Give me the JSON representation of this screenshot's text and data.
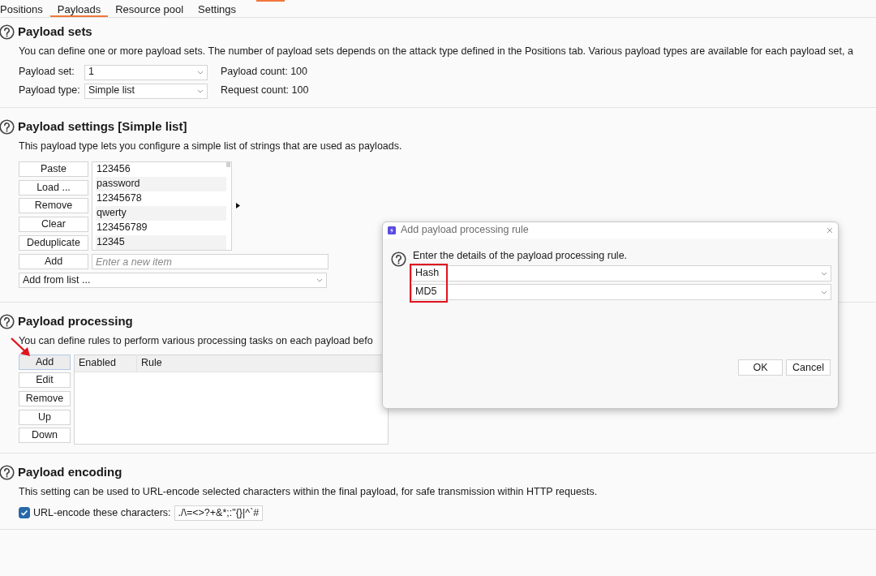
{
  "tabs": [
    {
      "label": "Positions",
      "selected": false
    },
    {
      "label": "Payloads",
      "selected": true
    },
    {
      "label": "Resource pool",
      "selected": false
    },
    {
      "label": "Settings",
      "selected": false
    }
  ],
  "payload_sets": {
    "title": "Payload sets",
    "description": "You can define one or more payload sets. The number of payload sets depends on the attack type defined in the Positions tab. Various payload types are available for each payload set, a",
    "payload_set_label": "Payload set:",
    "payload_set": "1",
    "payload_type_label": "Payload type:",
    "payload_type": "Simple list",
    "payload_count": "Payload count: 100",
    "request_count": "Request count: 100"
  },
  "payload_settings": {
    "title": "Payload settings [Simple list]",
    "description": "This payload type lets you configure a simple list of strings that are used as payloads.",
    "buttons": [
      "Paste",
      "Load ...",
      "Remove",
      "Clear",
      "Deduplicate"
    ],
    "items": [
      "123456",
      "password",
      "12345678",
      "qwerty",
      "123456789",
      "12345"
    ],
    "add_button": "Add",
    "new_item_placeholder": "Enter a new item",
    "add_from_list": "Add from list ..."
  },
  "payload_processing": {
    "title": "Payload processing",
    "description": "You can define rules to perform various processing tasks on each payload befo",
    "buttons": [
      {
        "label": "Add",
        "focused": true
      },
      {
        "label": "Edit",
        "focused": false
      },
      {
        "label": "Remove",
        "focused": false
      },
      {
        "label": "Up",
        "focused": false
      },
      {
        "label": "Down",
        "focused": false
      }
    ],
    "columns": [
      "Enabled",
      "Rule"
    ]
  },
  "payload_encoding": {
    "title": "Payload encoding",
    "description": "This setting can be used to URL-encode selected characters within the final payload, for safe transmission within HTTP requests.",
    "checkbox": {
      "label": "URL-encode these characters:",
      "checked": true
    },
    "characters": "./\\=<>?+&*;:\"{}|^`#"
  },
  "dialog": {
    "title": "Add payload processing rule",
    "message": "Enter the details of the payload processing rule.",
    "fields": [
      "Hash",
      "MD5"
    ],
    "buttons": [
      "OK",
      "Cancel"
    ]
  }
}
